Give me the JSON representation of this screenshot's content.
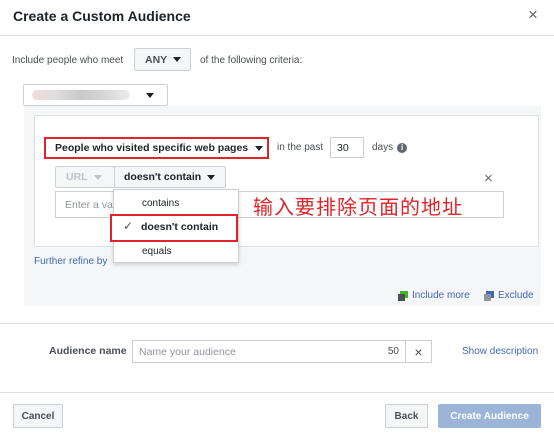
{
  "dialog": {
    "title": "Create a Custom Audience",
    "close_glyph": "×"
  },
  "criteria": {
    "prefix": "Include people who meet",
    "match_value": "ANY",
    "suffix": "of the following criteria:"
  },
  "rule": {
    "visitor_type": "People who visited specific web pages",
    "in_the_past": "in the past",
    "days_value": "30",
    "days_label": "days",
    "info_glyph": "i",
    "url_label": "URL",
    "operator_value": "doesn't contain",
    "url_placeholder": "Enter a val",
    "remove_glyph": "×"
  },
  "operator_menu": {
    "items": [
      {
        "label": "contains",
        "selected": false
      },
      {
        "label": "doesn't contain",
        "selected": true
      },
      {
        "label": "equals",
        "selected": false
      }
    ],
    "check_glyph": "✓"
  },
  "annotation": {
    "text": "输入要排除页面的地址",
    "color": "#e0242a"
  },
  "refine": {
    "label": "Further refine by"
  },
  "actions": {
    "include_more": "Include more",
    "exclude": "Exclude"
  },
  "audience": {
    "name_label": "Audience name",
    "name_placeholder": "Name your audience",
    "char_count": "50",
    "clear_glyph": "×",
    "show_description": "Show description"
  },
  "footer": {
    "cancel": "Cancel",
    "back": "Back",
    "create": "Create Audience"
  },
  "colors": {
    "link": "#4267b2",
    "highlight": "#e0242a",
    "primary_disabled": "#9cb4d8"
  }
}
